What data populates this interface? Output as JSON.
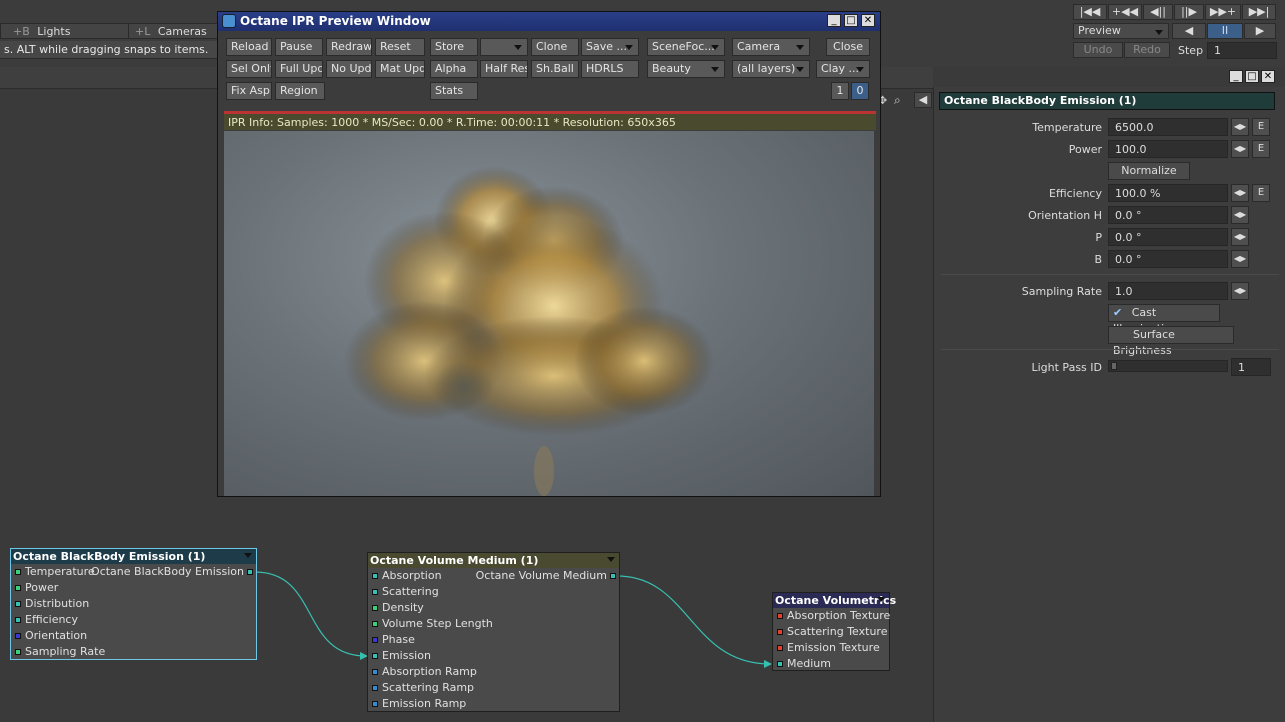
{
  "topbar": {
    "cells": [
      {
        "shortcut": "+B",
        "label": "Lights"
      },
      {
        "shortcut": "+L",
        "label": "Cameras"
      }
    ],
    "hint": "s. ALT while dragging snaps to items.",
    "transport": [
      "|◀◀",
      "+◀◀",
      "◀||",
      "||▶",
      "▶▶+",
      "▶▶|"
    ],
    "preview_label": "Preview",
    "undo_label": "Undo",
    "redo_label": "Redo",
    "step_label": "Step",
    "step_value": "1"
  },
  "ipr": {
    "title": "Octane IPR Preview Window",
    "row1": [
      "Reload",
      "Pause",
      "Redraw",
      "Reset",
      "Store",
      "",
      "Clone",
      "Save ...",
      "SceneFoc...",
      "Camera",
      "Close"
    ],
    "row2": [
      "Sel Only",
      "Full Upd.",
      "No Upd.",
      "Mat Upd",
      "Alpha",
      "Half Res",
      "Sh.Ball",
      "HDRLS",
      "Beauty",
      "(all layers)",
      "Clay ..."
    ],
    "row3": [
      "Fix Asp.",
      "Region",
      "Stats"
    ],
    "pages": [
      "1",
      "0"
    ],
    "info": "IPR Info:  Samples: 1000  *  MS/Sec: 0.00  *  R.Time: 00:00:11  *  Resolution: 650x365"
  },
  "props": {
    "header": "Octane BlackBody Emission (1)",
    "temperature_label": "Temperature",
    "temperature": "6500.0",
    "power_label": "Power",
    "power": "100.0",
    "normalize": "Normalize",
    "efficiency_label": "Efficiency",
    "efficiency": "100.0 %",
    "orientation_h_label": "Orientation H",
    "orientation_h": "0.0 °",
    "p_label": "P",
    "p": "0.0 °",
    "b_label": "B",
    "b": "0.0 °",
    "sampling_label": "Sampling Rate",
    "sampling": "1.0",
    "cast_illumination": "Cast Illumination",
    "surface_brightness": "Surface Brightness",
    "light_pass_label": "Light Pass ID",
    "light_pass": "1",
    "e_label": "E"
  },
  "nodes": {
    "blackbody": {
      "title": "Octane BlackBody Emission (1)",
      "output": "Octane BlackBody Emission",
      "inputs": [
        "Temperature",
        "Power",
        "Distribution",
        "Efficiency",
        "Orientation",
        "Sampling Rate"
      ]
    },
    "volume": {
      "title": "Octane Volume Medium (1)",
      "output": "Octane Volume Medium",
      "inputs": [
        "Absorption",
        "Scattering",
        "Density",
        "Volume Step Length",
        "Phase",
        "Emission",
        "Absorption Ramp",
        "Scattering Ramp",
        "Emission Ramp"
      ]
    },
    "volumetrics": {
      "title": "Octane Volumetrics",
      "inputs": [
        "Absorption Texture",
        "Scattering Texture",
        "Emission Texture",
        "Medium"
      ]
    }
  },
  "colors": {
    "ipr_title": "#1f3070",
    "selected_node_border": "#6fc7e8",
    "wire": "#37c0b0",
    "port_green": "#3fcf7a",
    "port_blue": "#3a3ad0",
    "port_red": "#e04030",
    "port_cyan": "#37c0b0"
  }
}
